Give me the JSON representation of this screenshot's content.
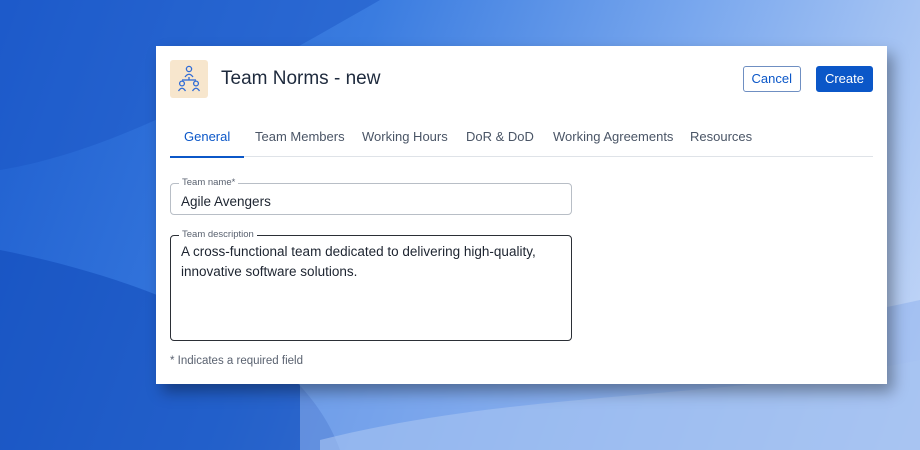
{
  "header": {
    "title": "Team Norms - new",
    "logo_icon": "team-hierarchy-icon",
    "cancel_label": "Cancel",
    "create_label": "Create"
  },
  "tabs": [
    {
      "label": "General",
      "active": true
    },
    {
      "label": "Team Members",
      "active": false
    },
    {
      "label": "Working Hours",
      "active": false
    },
    {
      "label": "DoR & DoD",
      "active": false
    },
    {
      "label": "Working Agreements",
      "active": false
    },
    {
      "label": "Resources",
      "active": false
    }
  ],
  "form": {
    "team_name": {
      "label": "Team name*",
      "value": "Agile Avengers"
    },
    "team_description": {
      "label": "Team description",
      "value": "A cross-functional team dedicated to delivering high-quality, innovative software solutions."
    },
    "required_note": "* Indicates a required field"
  },
  "colors": {
    "accent": "#0b57c8",
    "logo_bg": "#f7e6cd"
  }
}
